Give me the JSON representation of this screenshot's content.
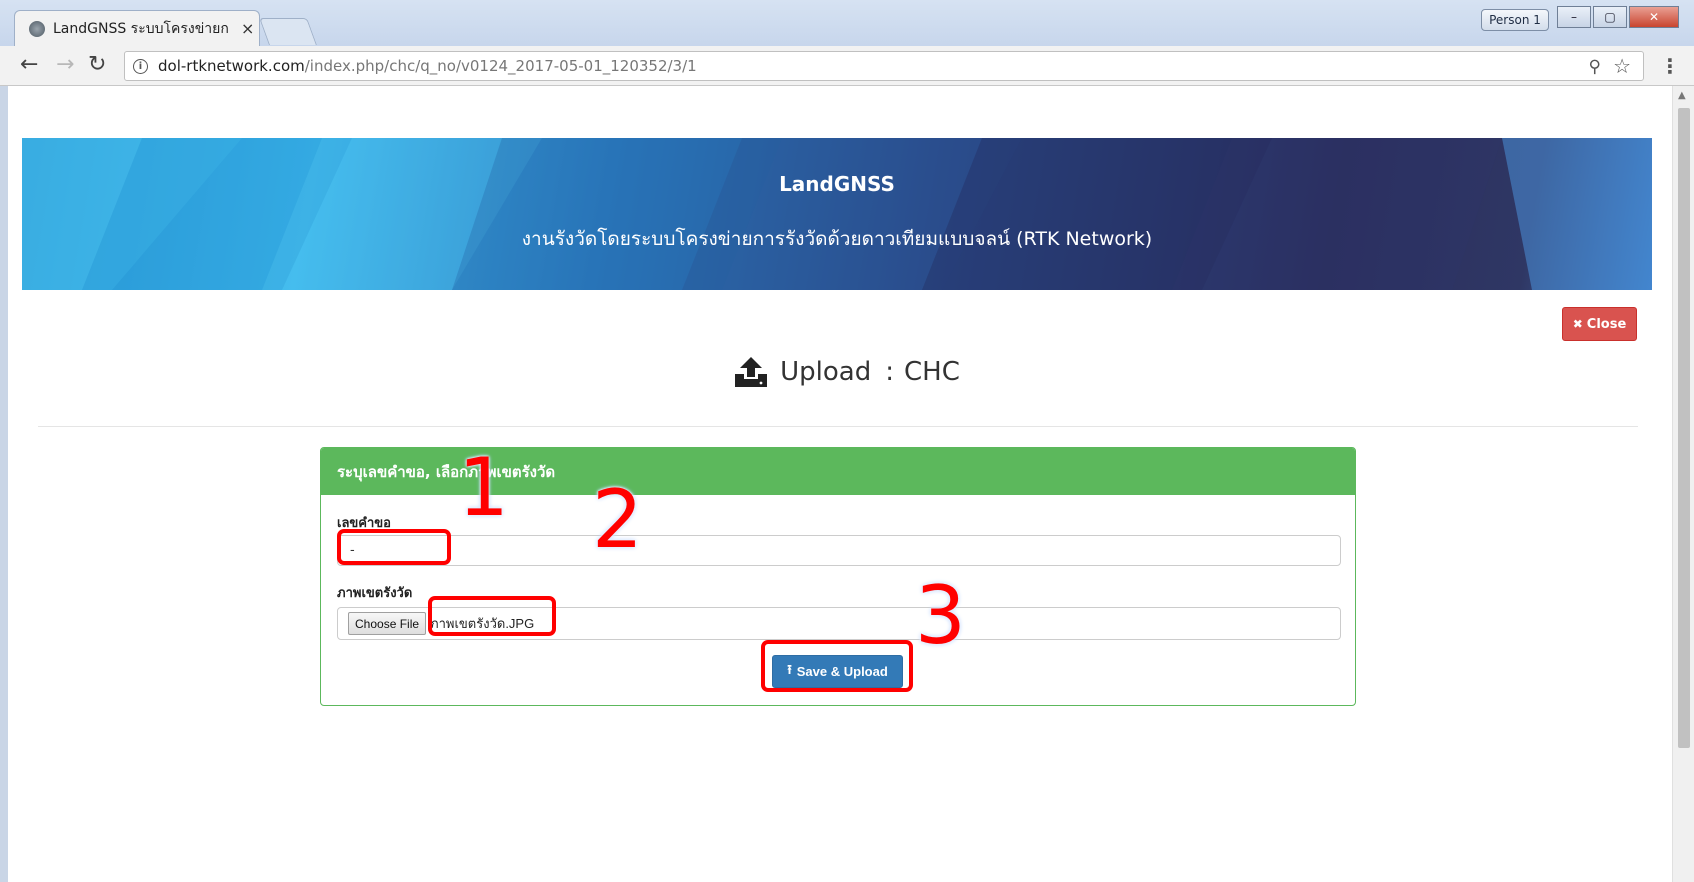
{
  "browser": {
    "tab_title": "LandGNSS ระบบโครงข่ายก",
    "tab_close": "×",
    "profile_label": "Person 1",
    "window_buttons": {
      "minimize": "–",
      "maximize": "▢",
      "close": "✕"
    },
    "url_host": "dol-rtknetwork.com",
    "url_path": "/index.php/chc/q_no/v0124_2017-05-01_120352/3/1",
    "icons": [
      "back-icon",
      "forward-icon",
      "reload-icon",
      "info-icon",
      "zoom-icon",
      "star-icon",
      "menu-icon"
    ]
  },
  "banner": {
    "title": "LandGNSS",
    "subtitle": "งานรังวัดโดยระบบโครงข่ายการรังวัดด้วยดาวเทียมแบบจลน์ (RTK Network)"
  },
  "close_button": {
    "label": "Close",
    "color": "#d9534f"
  },
  "page_heading": {
    "title": "Upload",
    "separator": ":",
    "subtitle": "CHC"
  },
  "form": {
    "panel_heading": "ระบุเลขคำขอ, เลือกภาพเขตรังวัด",
    "panel_color": "#5cb85c",
    "request_number": {
      "label": "เลขคำขอ",
      "value": "-"
    },
    "survey_image": {
      "label": "ภาพเขตรังวัด",
      "button_label": "Choose File",
      "file_name": "ภาพเขตรังวัด.JPG"
    },
    "submit": {
      "label": "Save & Upload",
      "color": "#337ab7"
    }
  },
  "annotations": {
    "color": "#ff0000",
    "steps": [
      "1",
      "2",
      "3"
    ]
  }
}
